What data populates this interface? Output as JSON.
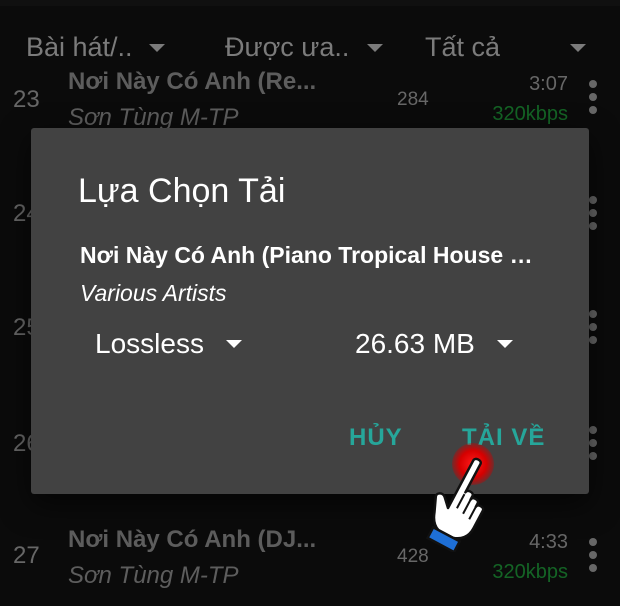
{
  "filters": [
    {
      "label": "Bài hát/.."
    },
    {
      "label": "Được ưa.."
    },
    {
      "label": "Tất cả"
    }
  ],
  "rows": [
    {
      "num": "23",
      "title": "Nơi Này Có Anh (Re...",
      "artist": "Sơn Tùng M-TP",
      "plays": "284",
      "duration": "3:07",
      "quality": "320kbps"
    },
    {
      "num": "24"
    },
    {
      "num": "25"
    },
    {
      "num": "26"
    },
    {
      "num": "27",
      "title": "Nơi Này Có Anh (DJ...",
      "artist": "Sơn Tùng M-TP",
      "plays": "428",
      "duration": "4:33",
      "quality": "320kbps"
    }
  ],
  "dialog": {
    "title": "Lựa Chọn Tải",
    "song_title": "Nơi Này Có Anh (Piano Tropical House Version)",
    "artist": "Various Artists",
    "quality_option": "Lossless",
    "size_option": "26.63 MB",
    "cancel_label": "HỦY",
    "download_label": "TẢI VỀ"
  },
  "colors": {
    "accent": "#26a69a",
    "quality_green": "#1f9a3a",
    "tap_marker": "#e00000"
  },
  "icons": {
    "menu": "more-vert-icon",
    "dropdown": "caret-down-icon",
    "pointer": "pointing-hand-icon"
  }
}
